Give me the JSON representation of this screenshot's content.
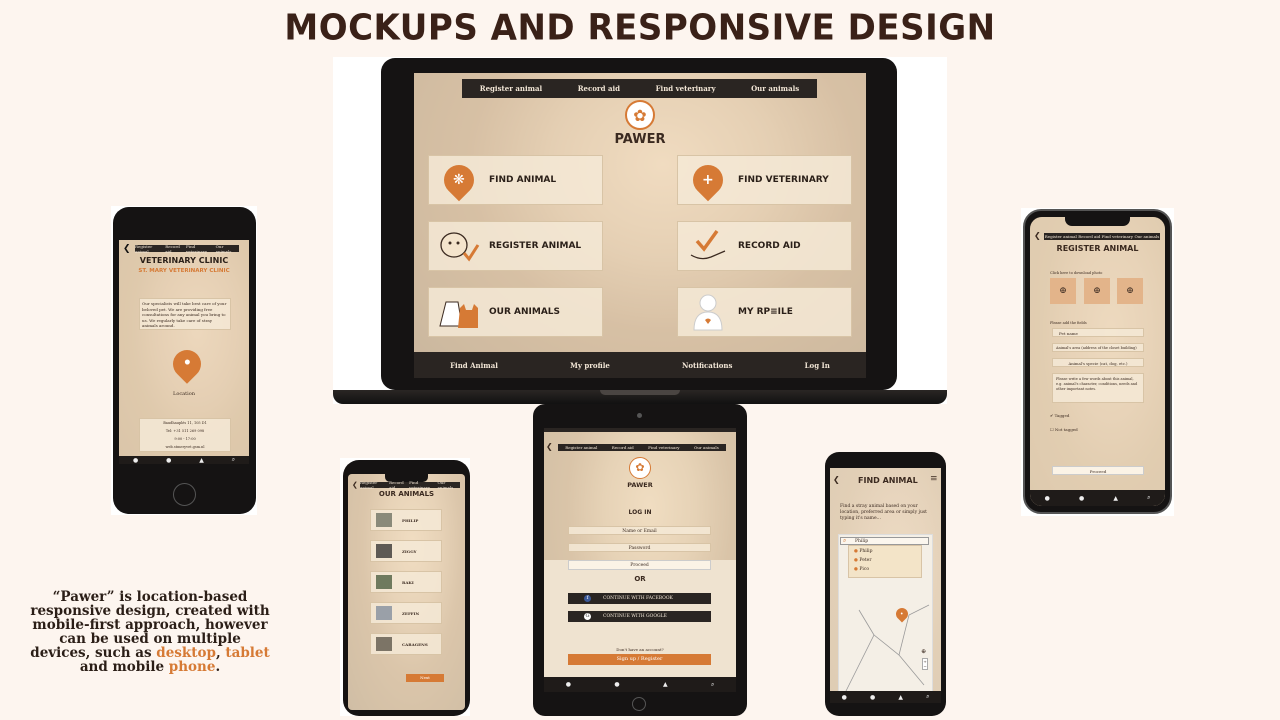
{
  "title": "MOCKUPS AND RESPONSIVE DESIGN",
  "laptop": {
    "top_nav": [
      "Register animal",
      "Record aid",
      "Find veterinary",
      "Our animals"
    ],
    "logo": "PAWER",
    "cards": [
      {
        "label": "FIND ANIMAL",
        "icon": "paw-pin-icon"
      },
      {
        "label": "FIND VETERINARY",
        "icon": "cross-pin-icon"
      },
      {
        "label": "REGISTER ANIMAL",
        "icon": "dog-check-icon"
      },
      {
        "label": "RECORD AID",
        "icon": "hand-check-icon"
      },
      {
        "label": "OUR ANIMALS",
        "icon": "cat-dog-icon"
      },
      {
        "label": "MY RP≡ILE",
        "icon": "profile-icon"
      }
    ],
    "bottom_nav": [
      "Find Animal",
      "My profile",
      "Notifications",
      "Log In"
    ]
  },
  "phone_clinic": {
    "nav": [
      "Register animal",
      "Record aid",
      "Find veterinary",
      "Our animals"
    ],
    "title": "VETERINARY CLINIC",
    "subtitle": "ST. MARY VETERINARY CLINIC",
    "description": "Our specialists will take best care of your beloved pet. We are providing free consultations for any animal you bring to us. We regularly take care of stray animals around.",
    "location_label": "Location",
    "address_lines": [
      "Baudhauplés 11, 105 D1",
      "Tel: +31 511 269 098",
      "9:00 - 17:00",
      "web.stmeryvet.gsm.nl"
    ]
  },
  "phone_animals": {
    "nav": [
      "Register animal",
      "Record aid",
      "Find veterinary",
      "Our animals"
    ],
    "title": "OUR ANIMALS",
    "animals": [
      "PHILIP",
      "ZIGGY",
      "RAKI",
      "ZEFFIN",
      "CARAGENS"
    ],
    "next_label": "Next"
  },
  "tablet": {
    "nav": [
      "Register animal",
      "Record aid",
      "Find veterinary",
      "Our animals"
    ],
    "logo": "PAWER",
    "login_title": "LOG IN",
    "name_placeholder": "Name or Email",
    "password_placeholder": "Password",
    "proceed": "Proceed",
    "or": "OR",
    "facebook": "CONTINUE WITH FACEBOOK",
    "google": "CONTINUE WITH GOOGLE",
    "no_account": "Don't have an account?",
    "signup": "Sign up / Register"
  },
  "phone_find": {
    "title": "FIND ANIMAL",
    "description": "Find a stray animal based on your location, preferred area or simply just typing it's name...",
    "search_value": "Philip",
    "results": [
      "Philip",
      "Peter",
      "Pico"
    ]
  },
  "phone_register": {
    "nav": [
      "Register animal",
      "Record aid",
      "Find veterinary",
      "Our animals"
    ],
    "title": "REGISTER ANIMAL",
    "upload_hint": "Click here to download photo",
    "fill_hint": "Please add the fields",
    "fields": [
      "Pet name",
      "Animal's area (address of the closet building)",
      "Animal's specie (cat, dog, etc.)",
      "Please write a few words about this animal, e.g. animal's character, conditions, needs and other important notes."
    ],
    "tagged": "Tagged",
    "not_tagged": "Not tagged",
    "proceed": "Proceed"
  },
  "caption": {
    "part1": "“Pawer” is location-based responsive design, created with mobile-first approach, however can be used on multiple devices, such as",
    "desktop": "desktop",
    "comma": ",",
    "tablet": "tablet",
    "and": "and mobile",
    "phone": "phone",
    "end": "."
  },
  "colors": {
    "accent": "#d67a35",
    "dark": "#2a2522",
    "background": "#fdf5ef"
  }
}
